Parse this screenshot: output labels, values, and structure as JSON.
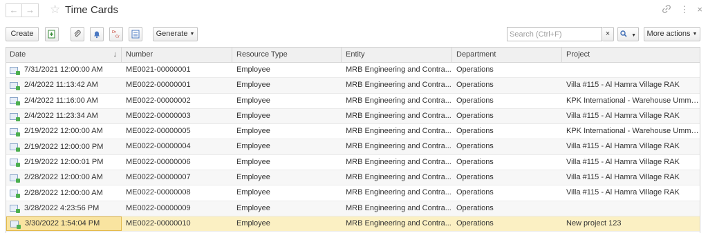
{
  "window": {
    "title": "Time Cards",
    "back_icon": "←",
    "forward_icon": "→",
    "favorite_icon": "☆",
    "link_icon": "🔗",
    "menu_icon": "⋮",
    "close_icon": "×"
  },
  "toolbar": {
    "create_label": "Create",
    "generate_label": "Generate",
    "search_placeholder": "Search (Ctrl+F)",
    "search_clear": "×",
    "more_actions_label": "More actions",
    "icons": [
      "copy-add-icon",
      "attachment-icon",
      "bell-icon",
      "dr-cr-icon",
      "report-structure-icon",
      "search-icon"
    ]
  },
  "columns": [
    {
      "label": "Date",
      "sorted": "descending"
    },
    {
      "label": "Number"
    },
    {
      "label": "Resource Type"
    },
    {
      "label": "Entity"
    },
    {
      "label": "Department"
    },
    {
      "label": "Project"
    }
  ],
  "rows": [
    {
      "date": "7/31/2021 12:00:00 AM",
      "number": "ME0021-00000001",
      "resource_type": "Employee",
      "entity": "MRB Engineering and Contra...",
      "department": "Operations",
      "project": ""
    },
    {
      "date": "2/4/2022 11:13:42 AM",
      "number": "ME0022-00000001",
      "resource_type": "Employee",
      "entity": "MRB Engineering and Contra...",
      "department": "Operations",
      "project": "Villa #115 - Al Hamra Village RAK"
    },
    {
      "date": "2/4/2022 11:16:00 AM",
      "number": "ME0022-00000002",
      "resource_type": "Employee",
      "entity": "MRB Engineering and Contra...",
      "department": "Operations",
      "project": "KPK International - Warehouse Umm S..."
    },
    {
      "date": "2/4/2022 11:23:34 AM",
      "number": "ME0022-00000003",
      "resource_type": "Employee",
      "entity": "MRB Engineering and Contra...",
      "department": "Operations",
      "project": "Villa #115 - Al Hamra Village RAK"
    },
    {
      "date": "2/19/2022 12:00:00 AM",
      "number": "ME0022-00000005",
      "resource_type": "Employee",
      "entity": "MRB Engineering and Contra...",
      "department": "Operations",
      "project": "KPK International - Warehouse Umm S..."
    },
    {
      "date": "2/19/2022 12:00:00 PM",
      "number": "ME0022-00000004",
      "resource_type": "Employee",
      "entity": "MRB Engineering and Contra...",
      "department": "Operations",
      "project": "Villa #115 - Al Hamra Village RAK"
    },
    {
      "date": "2/19/2022 12:00:01 PM",
      "number": "ME0022-00000006",
      "resource_type": "Employee",
      "entity": "MRB Engineering and Contra...",
      "department": "Operations",
      "project": "Villa #115 - Al Hamra Village RAK"
    },
    {
      "date": "2/28/2022 12:00:00 AM",
      "number": "ME0022-00000007",
      "resource_type": "Employee",
      "entity": "MRB Engineering and Contra...",
      "department": "Operations",
      "project": "Villa #115 - Al Hamra Village RAK"
    },
    {
      "date": "2/28/2022 12:00:00 AM",
      "number": "ME0022-00000008",
      "resource_type": "Employee",
      "entity": "MRB Engineering and Contra...",
      "department": "Operations",
      "project": "Villa #115 - Al Hamra Village RAK"
    },
    {
      "date": "3/28/2022 4:23:56 PM",
      "number": "ME0022-00000009",
      "resource_type": "Employee",
      "entity": "MRB Engineering and Contra...",
      "department": "Operations",
      "project": ""
    },
    {
      "date": "3/30/2022 1:54:04 PM",
      "number": "ME0022-00000010",
      "resource_type": "Employee",
      "entity": "MRB Engineering and Contra...",
      "department": "Operations",
      "project": "New project 123",
      "selected": true
    }
  ],
  "colors": {
    "selected_row": "#fbf0c3",
    "selected_cell_border": "#e2b94a",
    "header_bg": "#f0f0f0"
  }
}
